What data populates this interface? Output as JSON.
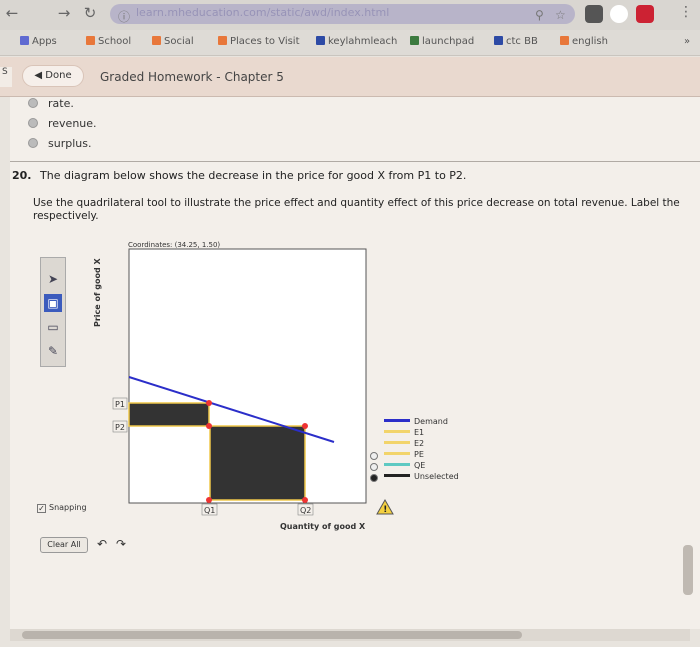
{
  "browser": {
    "url": "learn.mheducation.com/static/awd/index.html",
    "bookmarks": [
      {
        "label": "Apps",
        "color": "#5f6ad1"
      },
      {
        "label": "School",
        "color": "#e8773a"
      },
      {
        "label": "Social",
        "color": "#e8773a"
      },
      {
        "label": "Places to Visit",
        "color": "#e8773a"
      },
      {
        "label": "keylahmleach",
        "color": "#2d4aa5"
      },
      {
        "label": "launchpad",
        "color": "#3c7a3f"
      },
      {
        "label": "ctc BB",
        "color": "#2d4aa5"
      },
      {
        "label": "english",
        "color": "#e8773a"
      }
    ],
    "more": "»"
  },
  "header": {
    "side_tab": "S",
    "done_label": "Done",
    "title": "Graded Homework - Chapter 5"
  },
  "options": [
    "rate.",
    "revenue.",
    "surplus."
  ],
  "question": {
    "number": "20.",
    "text": "The diagram below shows the decrease in the price for good X from P1 to P2.",
    "instruction": "Use the quadrilateral tool to illustrate the price effect and quantity effect of this price decrease on total revenue. Label the respectively."
  },
  "graph": {
    "coordinates_label": "Coordinates: (34.25, 1.50)",
    "ylabel": "Price of good X",
    "xlabel": "Quantity of good X",
    "p1": "P1",
    "p2": "P2",
    "q1": "Q1",
    "q2": "Q2"
  },
  "legend": [
    {
      "label": "Demand",
      "color": "#2b2ec9"
    },
    {
      "label": "E1",
      "color": "#f2d46a"
    },
    {
      "label": "E2",
      "color": "#f2d46a"
    },
    {
      "label": "PE",
      "color": "#f2d46a"
    },
    {
      "label": "QE",
      "color": "#5ec9c2"
    },
    {
      "label": "Unselected",
      "color": "#222222"
    }
  ],
  "controls": {
    "snapping_label": "Snapping",
    "clear_label": "Clear All"
  }
}
